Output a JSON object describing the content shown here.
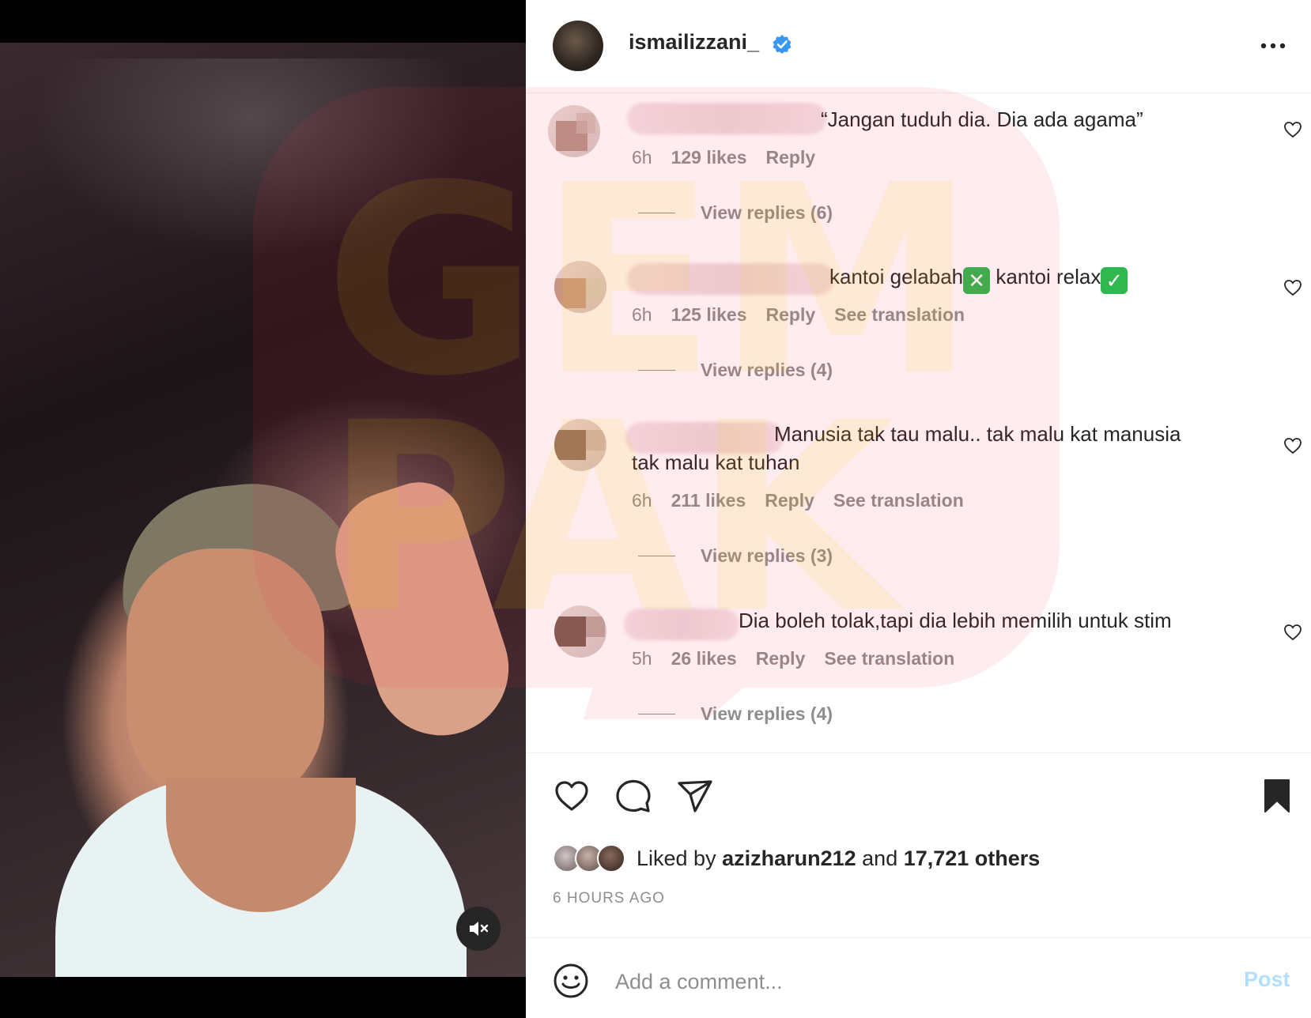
{
  "post": {
    "username": "ismailizzani_",
    "verified": true,
    "more_icon": "more-horizontal-icon"
  },
  "comments": [
    {
      "text": "“Jangan tuduh dia. Dia ada agama”",
      "time": "6h",
      "likes": "129 likes",
      "reply": "Reply",
      "see_translation": "",
      "view_replies": "View replies (6)"
    },
    {
      "text_a": "kantoi gelabah",
      "emoji_a": "✕",
      "text_b": " kantoi relax",
      "emoji_b": "✓",
      "time": "6h",
      "likes": "125 likes",
      "reply": "Reply",
      "see_translation": "See translation",
      "view_replies": "View replies (4)"
    },
    {
      "text_line1": "Manusia tak tau malu.. tak malu kat manusia",
      "text_line2": "tak malu kat tuhan",
      "time": "6h",
      "likes": "211 likes",
      "reply": "Reply",
      "see_translation": "See translation",
      "view_replies": "View replies (3)"
    },
    {
      "text": "Dia boleh tolak,tapi dia lebih memilih untuk stim",
      "time": "5h",
      "likes": "26 likes",
      "reply": "Reply",
      "see_translation": "See translation",
      "view_replies": "View replies (4)"
    }
  ],
  "likes": {
    "prefix": "Liked by ",
    "user": "azizharun212",
    "middle": " and ",
    "others": "17,721 others"
  },
  "time_ago": "6 HOURS AGO",
  "comment_box": {
    "placeholder": "Add a comment...",
    "post_label": "Post"
  },
  "icons": {
    "like": "heart-icon",
    "comment": "comment-icon",
    "share": "send-icon",
    "save": "bookmark-icon",
    "emoji": "smiley-icon",
    "mute": "speaker-muted-icon"
  },
  "colors": {
    "verified": "#3897f0",
    "muted_text": "#8e8e8e",
    "post_disabled": "#b2dffc",
    "emoji_green": "#2fb84f"
  }
}
